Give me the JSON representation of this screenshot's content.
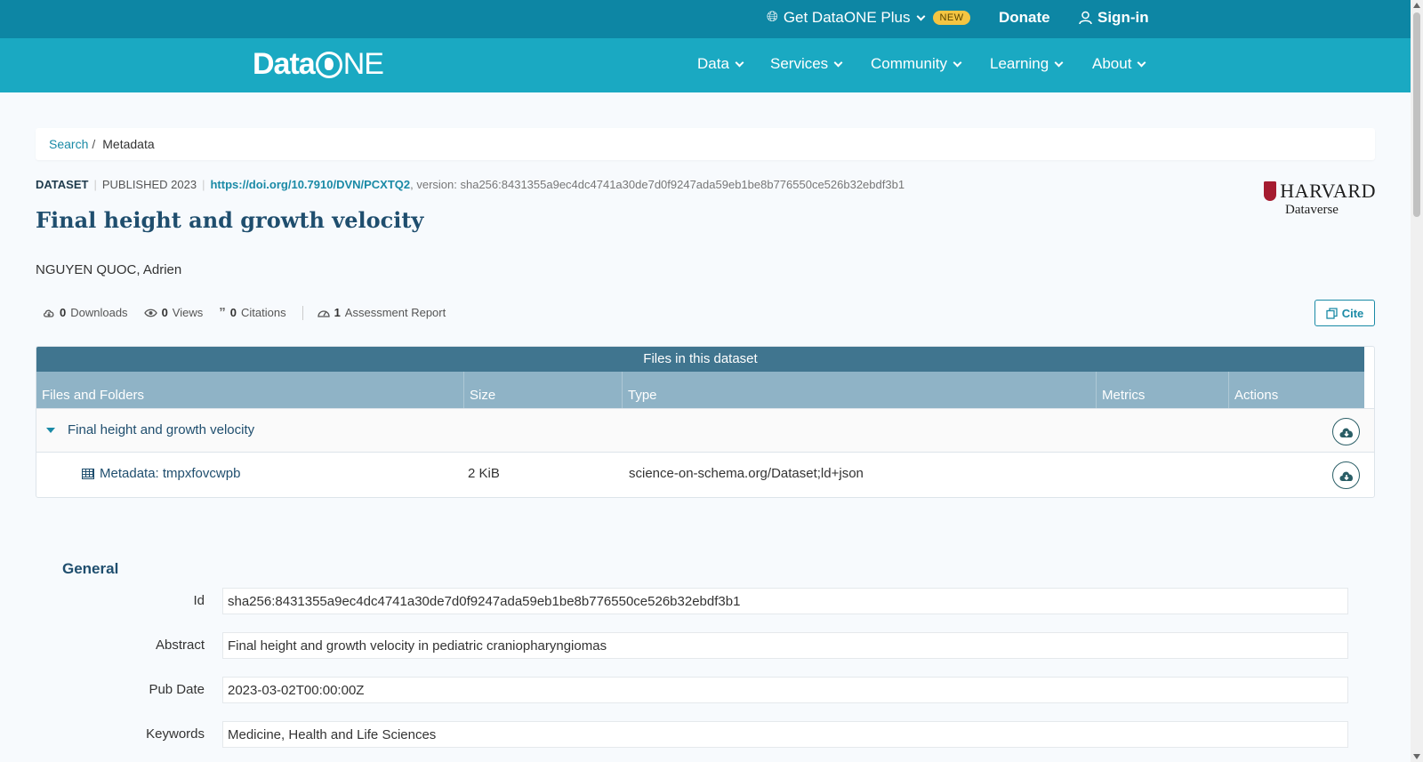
{
  "topbar": {
    "plus_label": "Get DataONE Plus",
    "new_badge": "NEW",
    "donate": "Donate",
    "signin": "Sign-in"
  },
  "logo": {
    "part1": "Data",
    "part2": "NE"
  },
  "nav": {
    "items": [
      {
        "label": "Data"
      },
      {
        "label": "Services"
      },
      {
        "label": "Community"
      },
      {
        "label": "Learning"
      },
      {
        "label": "About"
      }
    ]
  },
  "breadcrumb": {
    "search": "Search",
    "sep": "/",
    "current": "Metadata"
  },
  "header": {
    "type": "DATASET",
    "published": "PUBLISHED 2023",
    "doi": "https://doi.org/10.7910/DVN/PCXTQ2",
    "version": ", version: sha256:8431355a9ec4dc4741a30de7d0f9247ada59eb1be8b776550ce526b32ebdf3b1",
    "title": "Final height and growth velocity",
    "author": "NGUYEN QUOC, Adrien"
  },
  "repository": {
    "name": "HARVARD",
    "sub": "Dataverse"
  },
  "metrics": {
    "downloads_count": "0",
    "downloads_label": "Downloads",
    "views_count": "0",
    "views_label": "Views",
    "citations_count": "0",
    "citations_label": "Citations",
    "assessment_count": "1",
    "assessment_label": "Assessment Report"
  },
  "cite_label": "Cite",
  "files": {
    "caption": "Files in this dataset",
    "columns": [
      "Files and Folders",
      "Size",
      "Type",
      "Metrics",
      "Actions"
    ],
    "folder": {
      "name": "Final height and growth velocity"
    },
    "file": {
      "name": "Metadata: tmpxfovcwpb",
      "size": "2 KiB",
      "type": "science-on-schema.org/Dataset;ld+json"
    }
  },
  "general": {
    "title": "General",
    "fields": [
      {
        "label": "Id",
        "value": "sha256:8431355a9ec4dc4741a30de7d0f9247ada59eb1be8b776550ce526b32ebdf3b1"
      },
      {
        "label": "Abstract",
        "value": "Final height and growth velocity in pediatric craniopharyngiomas"
      },
      {
        "label": "Pub Date",
        "value": "2023-03-02T00:00:00Z"
      },
      {
        "label": "Keywords",
        "value": "Medicine, Health and Life Sciences"
      }
    ]
  },
  "colors": {
    "topbar": "#0d86a4",
    "navbar": "#1aa9c2",
    "accent": "#1a8aa6",
    "table_caption": "#40758f",
    "table_header": "#8fb3c6",
    "title": "#1f4e6e"
  }
}
